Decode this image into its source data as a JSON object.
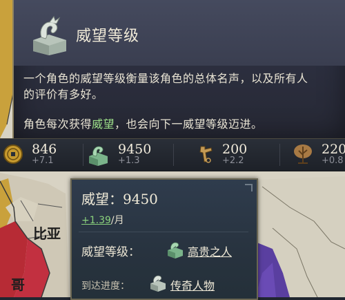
{
  "prestige_tooltip": {
    "title": "威望等级",
    "line1": "一个角色的威望等级衡量该角色的总体名声，以及所有人",
    "line2": "的评价有多好。",
    "line3_prefix": "角色每次获得",
    "line3_highlight": "威望",
    "line3_suffix": "，也会向下一威望等级迈进。"
  },
  "resources": [
    {
      "name": "gold",
      "icon": "coin-icon",
      "value": "846",
      "change": "+7.1"
    },
    {
      "name": "prestige",
      "icon": "jade-dragon-icon",
      "value": "9450",
      "change": "+1.3"
    },
    {
      "name": "piety",
      "icon": "piety-icon",
      "value": "200",
      "change": "+2.2"
    },
    {
      "name": "dynasty",
      "icon": "tree-icon",
      "value": "220",
      "change": "+0.8"
    }
  ],
  "map": {
    "label": "比亚",
    "label_partial": "哥"
  },
  "prestige_detail": {
    "title": "威望：9450",
    "rate_value": "+1.39",
    "rate_unit": "/月",
    "level_label": "威望等级：",
    "level_value": "高贵之人",
    "progress_label": "到达进度：",
    "progress_value": "传奇人物"
  },
  "colors": {
    "highlight_green": "#9ee08a",
    "panel_border": "#8d8261",
    "text_main": "#f0ead8"
  }
}
